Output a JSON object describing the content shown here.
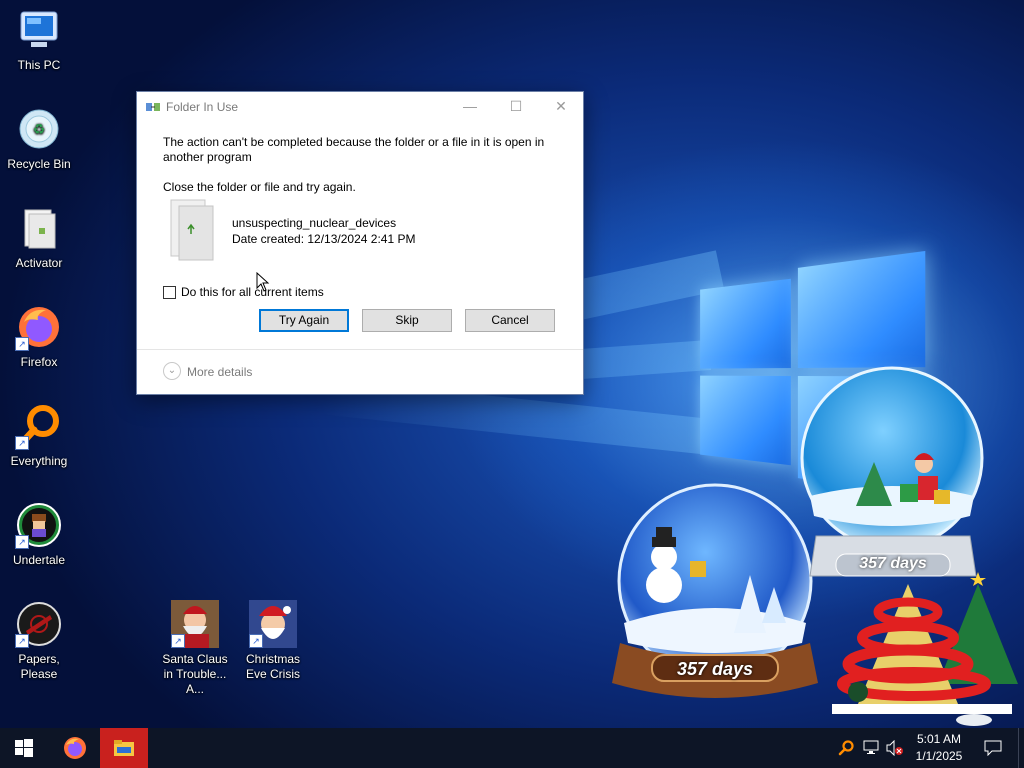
{
  "desktop_icons": [
    {
      "label": "This PC",
      "icon": "computer-icon"
    },
    {
      "label": "Recycle Bin",
      "icon": "recycle-bin-icon"
    },
    {
      "label": "Activator",
      "icon": "file-icon"
    },
    {
      "label": "Firefox",
      "icon": "firefox-icon"
    },
    {
      "label": "Everything",
      "icon": "search-app-icon"
    },
    {
      "label": "Undertale",
      "icon": "undertale-icon"
    },
    {
      "label": "Papers, Please",
      "icon": "papers-please-icon"
    },
    {
      "label": "Santa Claus in Trouble... A...",
      "icon": "santa-game-icon"
    },
    {
      "label": "Christmas Eve Crisis",
      "icon": "santa-game-icon"
    }
  ],
  "dialog": {
    "title": "Folder In Use",
    "message": "The action can't be completed because the folder or a file in it is open in another program",
    "instruction": "Close the folder or file and try again.",
    "file_name": "unsuspecting_nuclear_devices",
    "date_created": "Date created: 12/13/2024 2:41 PM",
    "checkbox_label": "Do this for all current items",
    "checkbox_checked": false,
    "buttons": {
      "try_again": "Try Again",
      "skip": "Skip",
      "cancel": "Cancel"
    },
    "more_details": "More details"
  },
  "widgets": {
    "globe_left_days": "357 days",
    "globe_right_days": "357 days"
  },
  "taskbar": {
    "time": "5:01 AM",
    "date": "1/1/2025",
    "pinned": [
      "start-icon",
      "firefox-icon",
      "file-explorer-icon"
    ],
    "tray": [
      "search-app-icon",
      "network-icon",
      "volume-muted-icon",
      "notification-icon"
    ]
  },
  "colors": {
    "accent": "#0078d7",
    "taskbar": "#0d1526",
    "active_app": "#c9211e"
  }
}
